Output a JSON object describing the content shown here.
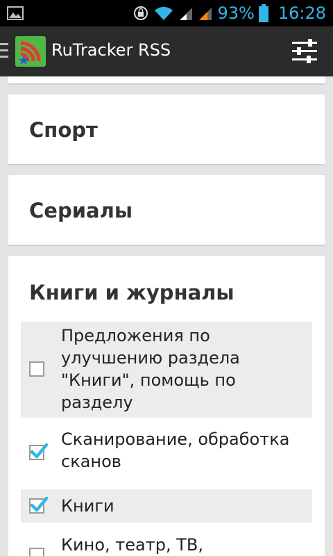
{
  "status_bar": {
    "battery": "93%",
    "time": "16:28"
  },
  "app_bar": {
    "title": "RuTracker RSS"
  },
  "categories": [
    {
      "title": "Спорт"
    },
    {
      "title": "Сериалы"
    },
    {
      "title": "Книги и журналы",
      "items": [
        {
          "label": "Предложения по\nулучшению раздела\n\"Книги\", помощь по\nразделу",
          "checked": false
        },
        {
          "label": "Сканирование, обработка\nсканов",
          "checked": true
        },
        {
          "label": "Книги",
          "checked": true
        },
        {
          "label": "Кино, театр, ТВ,",
          "checked": false
        }
      ]
    }
  ],
  "colors": {
    "accent": "#33b5e5",
    "logo_green": "#51b848",
    "checkbox_check": "#33b5e5"
  }
}
